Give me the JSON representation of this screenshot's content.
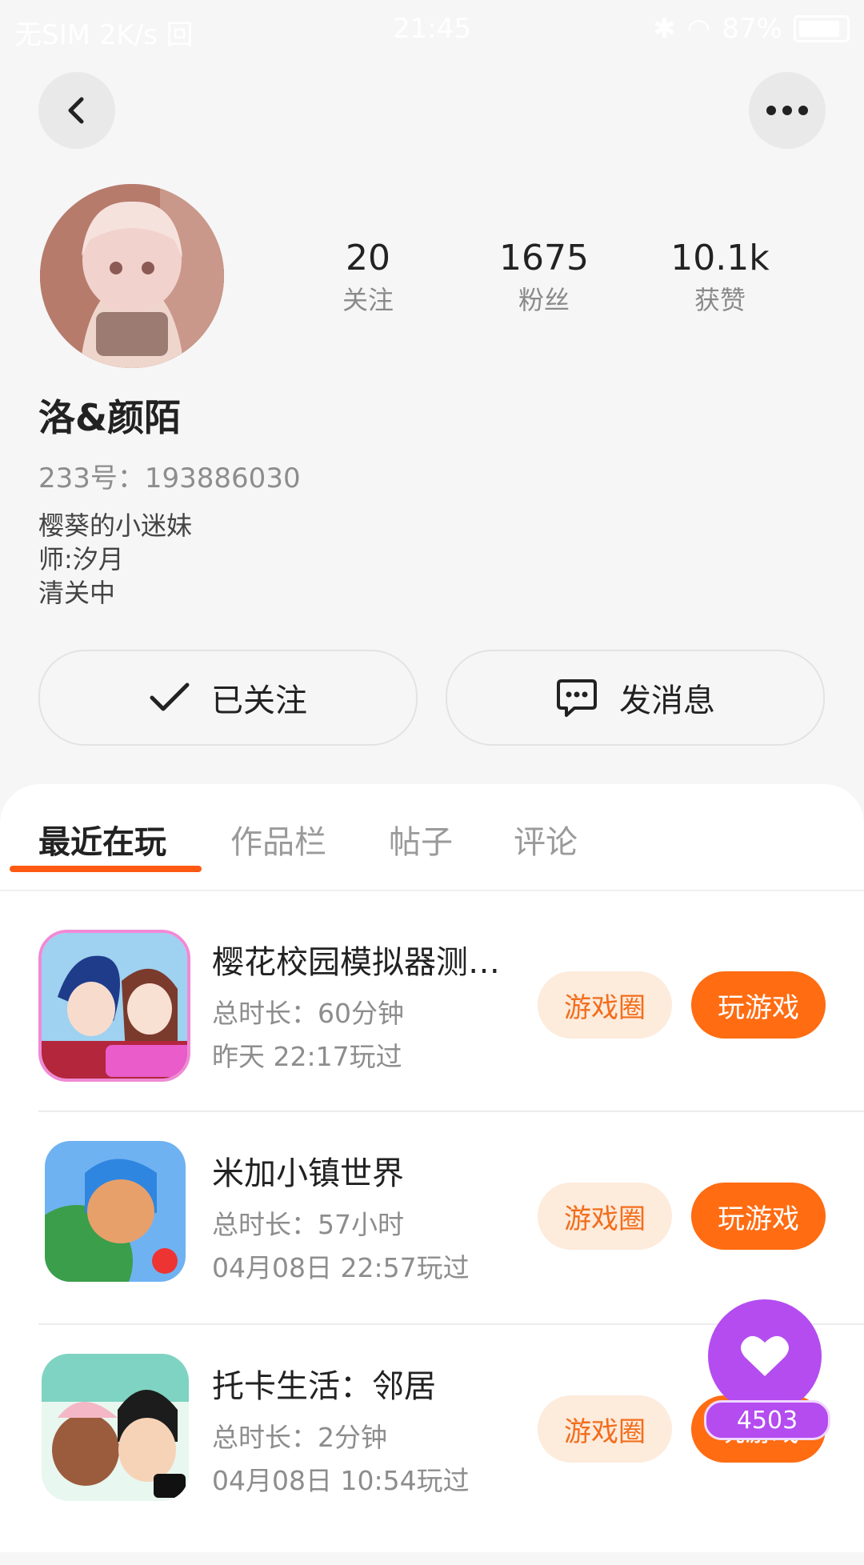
{
  "status_bar": {
    "carrier": "无SIM 2K/s 回",
    "time": "21:45",
    "battery": "87%"
  },
  "profile": {
    "stats": [
      {
        "value": "20",
        "label": "关注"
      },
      {
        "value": "1675",
        "label": "粉丝"
      },
      {
        "value": "10.1k",
        "label": "获赞"
      }
    ],
    "username": "洛&颜陌",
    "id_text": "233号：193886030",
    "bio": [
      "樱葵的小迷妹",
      "师:汐月",
      "清关中"
    ],
    "follow_label": "已关注",
    "message_label": "发消息"
  },
  "tabs": [
    "最近在玩",
    "作品栏",
    "帖子",
    "评论"
  ],
  "games": [
    {
      "title": "樱花校园模拟器测试版",
      "duration": "总时长：60分钟",
      "last_played": "昨天 22:17玩过",
      "circle_label": "游戏圈",
      "play_label": "玩游戏"
    },
    {
      "title": "米加小镇世界",
      "duration": "总时长：57小时",
      "last_played": "04月08日 22:57玩过",
      "circle_label": "游戏圈",
      "play_label": "玩游戏"
    },
    {
      "title": "托卡生活：邻居",
      "duration": "总时长：2分钟",
      "last_played": "04月08日 10:54玩过",
      "circle_label": "游戏圈",
      "play_label": "玩游戏"
    }
  ],
  "fab": {
    "count": "4503",
    "icon": "heart-icon"
  },
  "colors": {
    "accent": "#ff6c12",
    "accent_light": "#fdebdc",
    "fab": "#b44cf0"
  }
}
